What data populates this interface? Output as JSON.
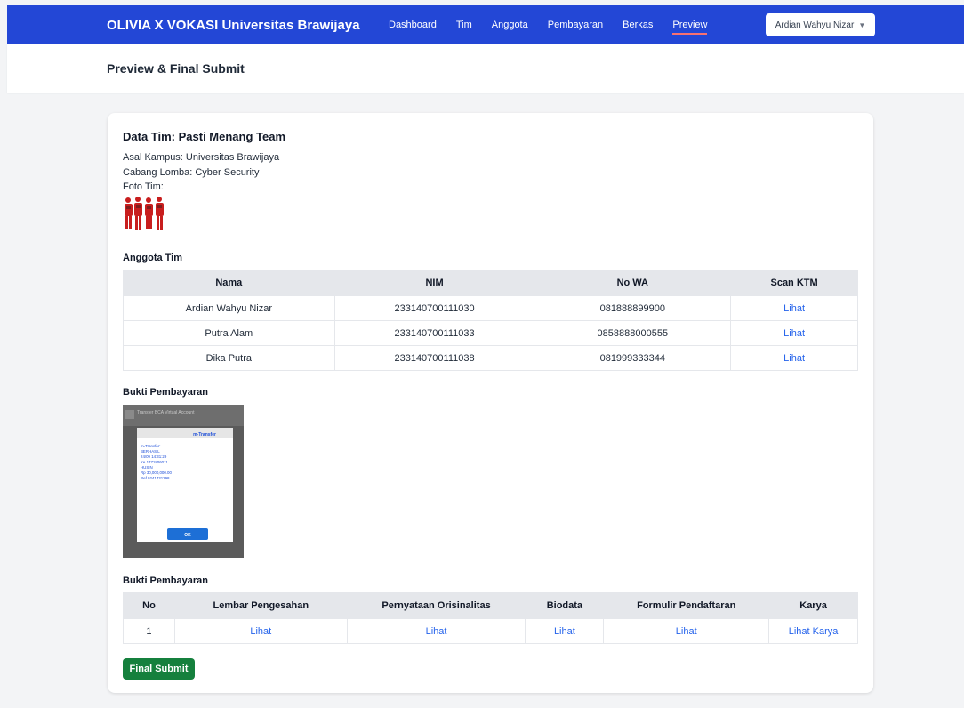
{
  "nav": {
    "brand": "OLIVIA X VOKASI Universitas Brawijaya",
    "links": [
      "Dashboard",
      "Tim",
      "Anggota",
      "Pembayaran",
      "Berkas",
      "Preview"
    ],
    "active": "Preview",
    "user": "Ardian Wahyu Nizar",
    "user_icon": "chevron-down-icon"
  },
  "header": {
    "title": "Preview & Final Submit"
  },
  "team": {
    "title": "Data Tim: Pasti Menang Team",
    "campus": "Asal Kampus: Universitas Brawijaya",
    "branch": "Cabang Lomba: Cyber Security",
    "photo_label": "Foto Tim:"
  },
  "members_section": {
    "title": "Anggota Tim",
    "headers": [
      "Nama",
      "NIM",
      "No WA",
      "Scan KTM"
    ],
    "rows": [
      [
        "Ardian Wahyu Nizar",
        "233140700111030",
        "081888899900",
        "Lihat"
      ],
      [
        "Putra Alam",
        "233140700111033",
        "0858888000555",
        "Lihat"
      ],
      [
        "Dika Putra",
        "233140700111038",
        "081999333344",
        "Lihat"
      ]
    ]
  },
  "payment": {
    "title": "Bukti Pembayaran",
    "screenshot": {
      "header": "Transfer BCA Virtual Account",
      "dialog_title": "m-Transfer",
      "lines": [
        "m-Transfer:",
        "BERHASIL",
        "24/09 14:31:29",
        "Ke 1771806011",
        "HUSIN",
        "Rp 30,000,000.00",
        "Ref 0241431298"
      ],
      "ok": "OK"
    }
  },
  "files_section": {
    "title": "Bukti Pembayaran",
    "headers": [
      "No",
      "Lembar Pengesahan",
      "Pernyataan Orisinalitas",
      "Biodata",
      "Formulir Pendaftaran",
      "Karya"
    ],
    "rows": [
      [
        "1",
        "Lihat",
        "Lihat",
        "Lihat",
        "Lihat",
        "Lihat Karya"
      ]
    ]
  },
  "submit_label": "Final Submit",
  "colors": {
    "nav": "#2347d6",
    "link": "#2563eb",
    "submit": "#15803d",
    "active_underline": "#f87171"
  }
}
